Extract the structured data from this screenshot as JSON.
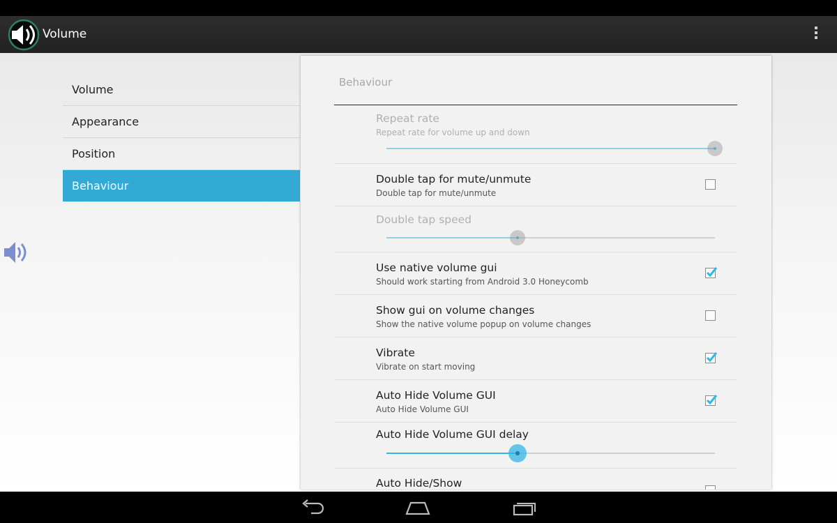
{
  "app": {
    "title": "Volume",
    "icon": "speaker-icon"
  },
  "headers": [
    {
      "label": "Volume",
      "selected": false
    },
    {
      "label": "Appearance",
      "selected": false
    },
    {
      "label": "Position",
      "selected": false
    },
    {
      "label": "Behaviour",
      "selected": true
    }
  ],
  "panel": {
    "title": "Behaviour",
    "repeat_rate": {
      "title": "Repeat rate",
      "summary": "Repeat rate for volume up and down",
      "enabled": false,
      "value": 1.0
    },
    "double_tap": {
      "title": "Double tap for mute/unmute",
      "summary": "Double tap for mute/unmute",
      "checked": false
    },
    "double_tap_speed": {
      "title": "Double tap speed",
      "enabled": false,
      "value": 0.4
    },
    "native_gui": {
      "title": "Use native volume gui",
      "summary": "Should work starting from Android 3.0 Honeycomb",
      "checked": true
    },
    "show_gui": {
      "title": "Show gui on volume changes",
      "summary": "Show the native volume popup on volume changes",
      "checked": false
    },
    "vibrate": {
      "title": "Vibrate",
      "summary": "Vibrate on start moving",
      "checked": true
    },
    "auto_hide": {
      "title": "Auto Hide Volume GUI",
      "summary": "Auto Hide Volume GUI",
      "checked": true
    },
    "auto_hide_delay": {
      "title": "Auto Hide Volume GUI delay",
      "enabled": true,
      "value": 0.4
    },
    "auto_hide_show": {
      "title": "Auto Hide/Show",
      "checked": false
    }
  },
  "colors": {
    "accent": "#33b5e5",
    "selected_header": "#33a9d6",
    "action_bar": "#282828"
  },
  "nav": {
    "back": "back-icon",
    "home": "home-icon",
    "recents": "recents-icon"
  }
}
